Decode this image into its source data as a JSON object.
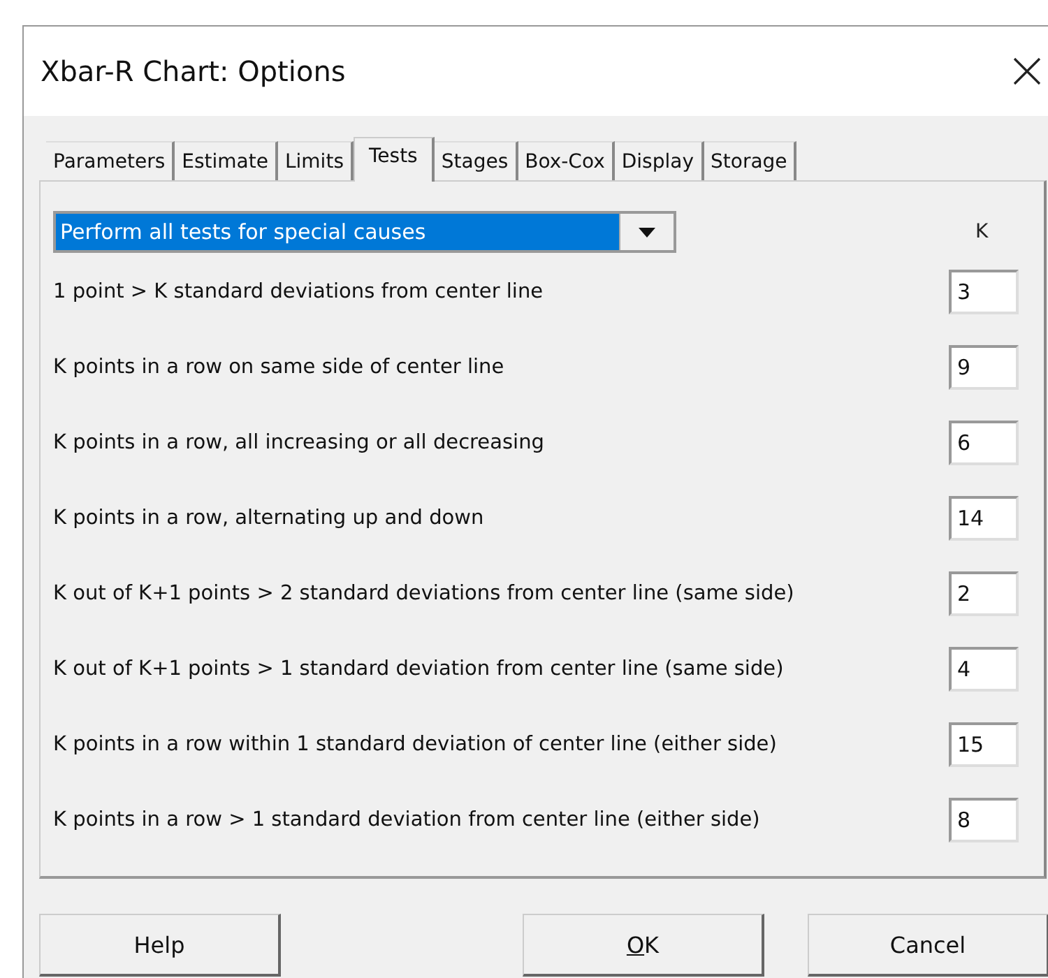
{
  "window": {
    "title": "Xbar-R Chart: Options"
  },
  "tabs": [
    {
      "label": "Parameters",
      "selected": false
    },
    {
      "label": "Estimate",
      "selected": false
    },
    {
      "label": "Limits",
      "selected": false
    },
    {
      "label": "Tests",
      "selected": true
    },
    {
      "label": "Stages",
      "selected": false
    },
    {
      "label": "Box-Cox",
      "selected": false
    },
    {
      "label": "Display",
      "selected": false
    },
    {
      "label": "Storage",
      "selected": false
    }
  ],
  "dropdown": {
    "value": "Perform all tests for special causes"
  },
  "k_header": "K",
  "tests": [
    {
      "label": "1 point > K standard deviations from center line",
      "k": "3"
    },
    {
      "label": "K points in a row on same side of center line",
      "k": "9"
    },
    {
      "label": "K points in a row, all increasing or all decreasing",
      "k": "6"
    },
    {
      "label": "K points in a row, alternating up and down",
      "k": "14"
    },
    {
      "label": "K out of K+1 points > 2 standard deviations from center line (same side)",
      "k": "2"
    },
    {
      "label": "K out of K+1 points > 1 standard deviation from center line (same side)",
      "k": "4"
    },
    {
      "label": "K points in a row within 1 standard deviation of center line (either side)",
      "k": "15"
    },
    {
      "label": "K points in a row > 1 standard deviation from center line (either side)",
      "k": "8"
    }
  ],
  "buttons": [
    {
      "label": "Help",
      "kind": "plain"
    },
    {
      "label": "OK",
      "kind": "accel"
    },
    {
      "label": "Cancel",
      "kind": "plain"
    }
  ]
}
